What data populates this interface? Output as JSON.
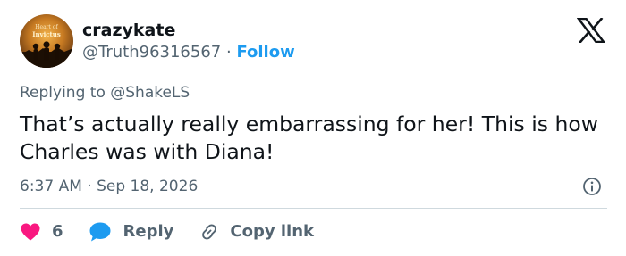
{
  "user": {
    "display_name": "crazykate",
    "handle": "@Truth96316567",
    "separator": "·",
    "follow_label": "Follow",
    "avatar_text_top": "Heart of",
    "avatar_text_main": "Invictus"
  },
  "reply_context": {
    "prefix": "Replying to ",
    "mention": "@ShakeLS"
  },
  "tweet": {
    "text": "That’s actually really embarrassing for her! This is how Charles was with Diana!",
    "time": "6:37 AM",
    "time_separator": " · ",
    "date": "Sep 18, 2026"
  },
  "actions": {
    "like_count": "6",
    "reply_label": "Reply",
    "copy_link_label": "Copy link"
  },
  "icons": {
    "logo": "x-logo-icon",
    "info": "info-icon",
    "like": "heart-icon",
    "reply": "speech-bubble-icon",
    "copy_link": "link-icon"
  },
  "colors": {
    "text_primary": "#0f1419",
    "text_secondary": "#536471",
    "accent_blue": "#1d9bf0",
    "like_pink": "#f91880",
    "divider": "#cfd9de"
  }
}
